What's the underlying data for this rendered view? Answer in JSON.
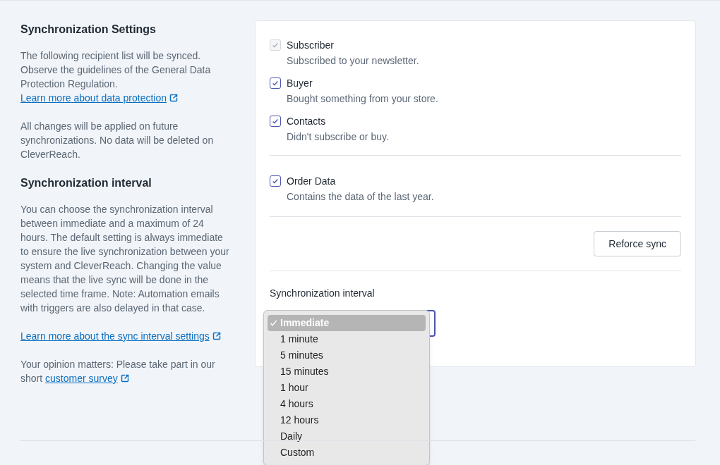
{
  "info": {
    "sections": [
      {
        "title": "Synchronization Settings",
        "paragraphs": [
          {
            "text": "The following recipient list will be synced. Observe the guidelines of the General Data Protection Regulation. ",
            "link": "Learn more about data protection"
          },
          {
            "text": "All changes will be applied on future synchronizations. No data will be deleted on CleverReach."
          }
        ]
      },
      {
        "title": "Synchronization interval",
        "paragraphs": [
          {
            "text": "You can choose the synchronization interval between immediate and a maximum of 24 hours. The default setting is always immediate to ensure the live synchronization between your system and CleverReach. Changing the value means that the live sync will be done in the selected time frame. Note: Automation emails with triggers are also delayed in that case."
          },
          {
            "link": "Learn more about the sync interval settings"
          },
          {
            "text": "Your opinion matters: Please take part in our short ",
            "link": "customer survey"
          }
        ]
      }
    ]
  },
  "recipients": [
    {
      "label": "Subscriber",
      "description": "Subscribed to your newsletter.",
      "checked": true,
      "disabled": true
    },
    {
      "label": "Buyer",
      "description": "Bought something from your store.",
      "checked": true,
      "disabled": false
    },
    {
      "label": "Contacts",
      "description": "Didn't subscribe or buy.",
      "checked": true,
      "disabled": false
    }
  ],
  "order_data": {
    "label": "Order Data",
    "description": "Contains the data of the last year.",
    "checked": true,
    "disabled": false
  },
  "reforce_button": "Reforce sync",
  "interval": {
    "label": "Synchronization interval",
    "options": [
      {
        "label": "Immediate",
        "selected": true
      },
      {
        "label": "1 minute",
        "selected": false
      },
      {
        "label": "5 minutes",
        "selected": false
      },
      {
        "label": "15 minutes",
        "selected": false
      },
      {
        "label": "1 hour",
        "selected": false
      },
      {
        "label": "4 hours",
        "selected": false
      },
      {
        "label": "12 hours",
        "selected": false
      },
      {
        "label": "Daily",
        "selected": false
      },
      {
        "label": "Custom",
        "selected": false
      }
    ]
  }
}
